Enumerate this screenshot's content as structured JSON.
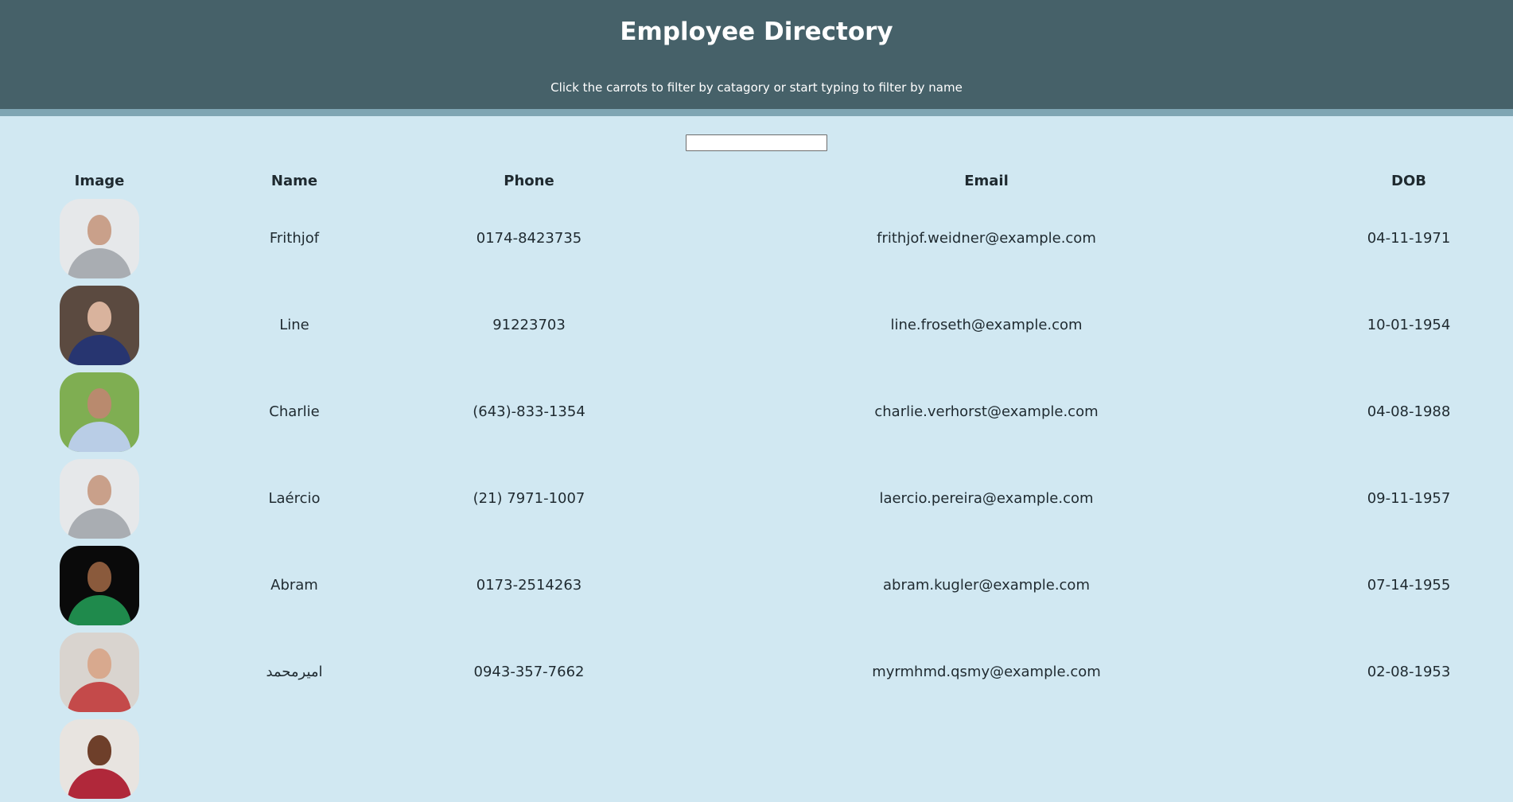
{
  "header": {
    "title": "Employee Directory",
    "subtitle": "Click the carrots to filter by catagory or start typing to filter by name"
  },
  "search": {
    "value": "",
    "placeholder": ""
  },
  "table": {
    "columns": [
      "Image",
      "Name",
      "Phone",
      "Email",
      "DOB"
    ],
    "rows": [
      {
        "name": "Frithjof",
        "phone": "0174-8423735",
        "email": "frithjof.weidner@example.com",
        "dob": "04-11-1971",
        "avatar": {
          "bg": "#e6e8ea",
          "skin": "#c9a08a",
          "shirt": "#a9adb2"
        }
      },
      {
        "name": "Line",
        "phone": "91223703",
        "email": "line.froseth@example.com",
        "dob": "10-01-1954",
        "avatar": {
          "bg": "#5b4a40",
          "skin": "#d9b39d",
          "shirt": "#273570"
        }
      },
      {
        "name": "Charlie",
        "phone": "(643)-833-1354",
        "email": "charlie.verhorst@example.com",
        "dob": "04-08-1988",
        "avatar": {
          "bg": "#7fae52",
          "skin": "#b98a6e",
          "shirt": "#b9cde6"
        }
      },
      {
        "name": "Laércio",
        "phone": "(21) 7971-1007",
        "email": "laercio.pereira@example.com",
        "dob": "09-11-1957",
        "avatar": {
          "bg": "#e6e8ea",
          "skin": "#c9a08a",
          "shirt": "#a9adb2"
        }
      },
      {
        "name": "Abram",
        "phone": "0173-2514263",
        "email": "abram.kugler@example.com",
        "dob": "07-14-1955",
        "avatar": {
          "bg": "#0a0a0a",
          "skin": "#8a5a3c",
          "shirt": "#1f8a4c"
        }
      },
      {
        "name": "اميرمحمد",
        "phone": "0943-357-7662",
        "email": "myrmhmd.qsmy@example.com",
        "dob": "02-08-1953",
        "avatar": {
          "bg": "#d9d4cf",
          "skin": "#d8a98e",
          "shirt": "#c44a4a"
        }
      },
      {
        "name": "",
        "phone": "",
        "email": "",
        "dob": "",
        "avatar": {
          "bg": "#e8e4e0",
          "skin": "#6e3f2a",
          "shirt": "#b0283a"
        }
      }
    ]
  }
}
